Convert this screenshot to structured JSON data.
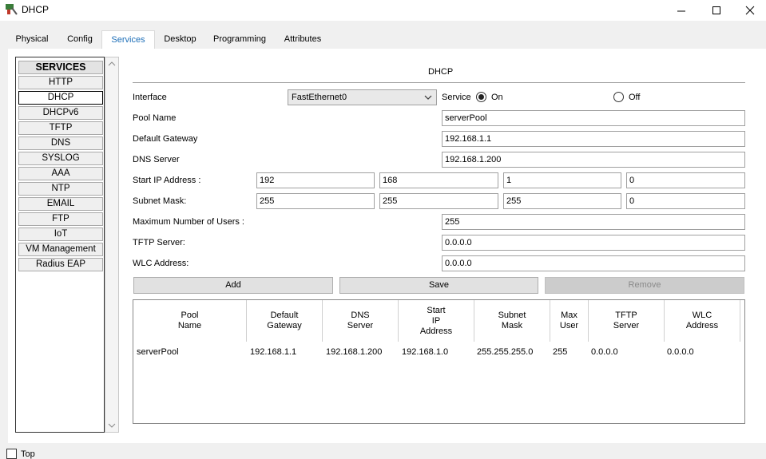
{
  "window": {
    "title": "DHCP"
  },
  "tabs": [
    "Physical",
    "Config",
    "Services",
    "Desktop",
    "Programming",
    "Attributes"
  ],
  "services": {
    "header": "SERVICES",
    "items": [
      "HTTP",
      "DHCP",
      "DHCPv6",
      "TFTP",
      "DNS",
      "SYSLOG",
      "AAA",
      "NTP",
      "EMAIL",
      "FTP",
      "IoT",
      "VM Management",
      "Radius EAP"
    ],
    "selected": "DHCP"
  },
  "dhcp": {
    "title": "DHCP",
    "interface_label": "Interface",
    "interface_value": "FastEthernet0",
    "service_label": "Service",
    "on_label": "On",
    "off_label": "Off",
    "pool_name_label": "Pool Name",
    "pool_name": "serverPool",
    "gateway_label": "Default Gateway",
    "gateway": "192.168.1.1",
    "dns_label": "DNS Server",
    "dns": "192.168.1.200",
    "start_ip_label": "Start IP Address :",
    "start_ip": [
      "192",
      "168",
      "1",
      "0"
    ],
    "subnet_label": "Subnet Mask:",
    "subnet": [
      "255",
      "255",
      "255",
      "0"
    ],
    "max_users_label": "Maximum Number of Users :",
    "max_users": "255",
    "tftp_label": "TFTP Server:",
    "tftp": "0.0.0.0",
    "wlc_label": "WLC Address:",
    "wlc": "0.0.0.0",
    "buttons": {
      "add": "Add",
      "save": "Save",
      "remove": "Remove"
    }
  },
  "table": {
    "headers": [
      "Pool\nName",
      "Default\nGateway",
      "DNS\nServer",
      "Start\nIP\nAddress",
      "Subnet\nMask",
      "Max\nUser",
      "TFTP\nServer",
      "WLC\nAddress"
    ],
    "rows": [
      [
        "serverPool",
        "192.168.1.1",
        "192.168.1.200",
        "192.168.1.0",
        "255.255.255.0",
        "255",
        "0.0.0.0",
        "0.0.0.0"
      ]
    ]
  },
  "footer": {
    "top_label": "Top"
  },
  "colors": {
    "accent": "#1e90d0",
    "active_tab_text": "#1e6fb8"
  }
}
